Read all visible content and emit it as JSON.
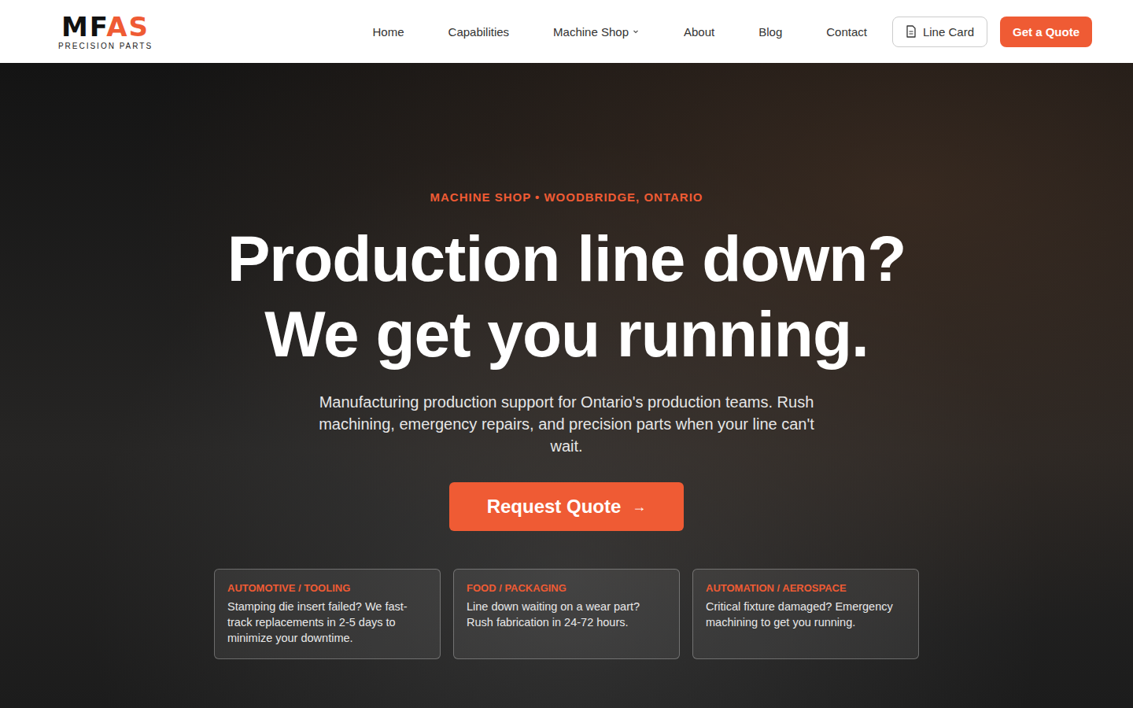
{
  "header": {
    "logo": {
      "mark_dark": "MF",
      "mark_accent": "AS",
      "tagline": "PRECISION PARTS"
    },
    "nav": [
      {
        "label": "Home",
        "has_dropdown": false
      },
      {
        "label": "Capabilities",
        "has_dropdown": false
      },
      {
        "label": "Machine Shop",
        "has_dropdown": true
      },
      {
        "label": "About",
        "has_dropdown": false
      },
      {
        "label": "Blog",
        "has_dropdown": false
      },
      {
        "label": "Contact",
        "has_dropdown": false
      }
    ],
    "line_card_button": "Line Card",
    "quote_button": "Get a Quote"
  },
  "hero": {
    "eyebrow": "MACHINE SHOP • WOODBRIDGE, ONTARIO",
    "title_lines": [
      "Production line down?",
      "We get you running."
    ],
    "subtitle": "Manufacturing production support for Ontario's production teams. Rush machining, emergency repairs, and precision parts when your line can't wait.",
    "cta": {
      "label": "Request Quote",
      "arrow": "→"
    },
    "cards": [
      {
        "tag": "AUTOMOTIVE / TOOLING",
        "text": "Stamping die insert failed? We fast-track replacements in 2-5 days to minimize your downtime."
      },
      {
        "tag": "FOOD / PACKAGING",
        "text": "Line down waiting on a wear part? Rush fabrication in 24-72 hours."
      },
      {
        "tag": "AUTOMATION / AEROSPACE",
        "text": "Critical fixture damaged? Emergency machining to get you running."
      }
    ]
  }
}
